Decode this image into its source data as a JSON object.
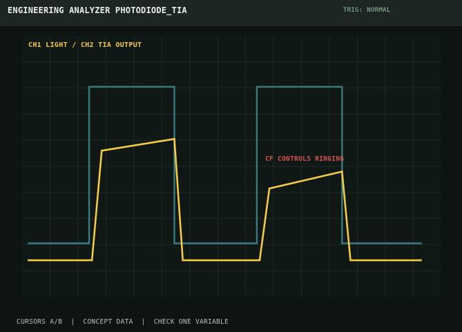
{
  "header": {
    "app_title": "ENGINEERING ANALYZER  PHOTODIODE_TIA",
    "trigger_label": "TRIG: NORMAL"
  },
  "scope": {
    "title": "CH1 LIGHT / CH2 TIA OUTPUT",
    "annotation": "CF CONTROLS RINGING"
  },
  "status": {
    "items": [
      "CURSORS A/B",
      "CONCEPT DATA",
      "CHECK ONE VARIABLE"
    ],
    "separator": "|"
  },
  "colors": {
    "ch1": "#3a7a82",
    "ch2": "#f4cc43",
    "grid": "#1f2a27",
    "annotation": "#d6554f"
  },
  "chart_data": {
    "type": "line",
    "x_divisions": 15,
    "y_divisions": 10,
    "series": [
      {
        "name": "CH1 LIGHT",
        "x": [
          0.2,
          2.4,
          2.4,
          5.45,
          5.45,
          8.4,
          8.4,
          11.45,
          11.45,
          14.3
        ],
        "y": [
          2.05,
          2.05,
          8.05,
          8.05,
          2.05,
          2.05,
          8.05,
          8.05,
          2.05,
          2.05
        ]
      },
      {
        "name": "CH2 TIA OUTPUT",
        "x": [
          0.2,
          2.5,
          2.85,
          5.45,
          5.75,
          8.5,
          8.85,
          11.45,
          11.75,
          14.3
        ],
        "y": [
          1.4,
          1.4,
          5.6,
          6.05,
          1.4,
          1.4,
          4.15,
          4.8,
          1.4,
          1.4
        ]
      }
    ]
  }
}
